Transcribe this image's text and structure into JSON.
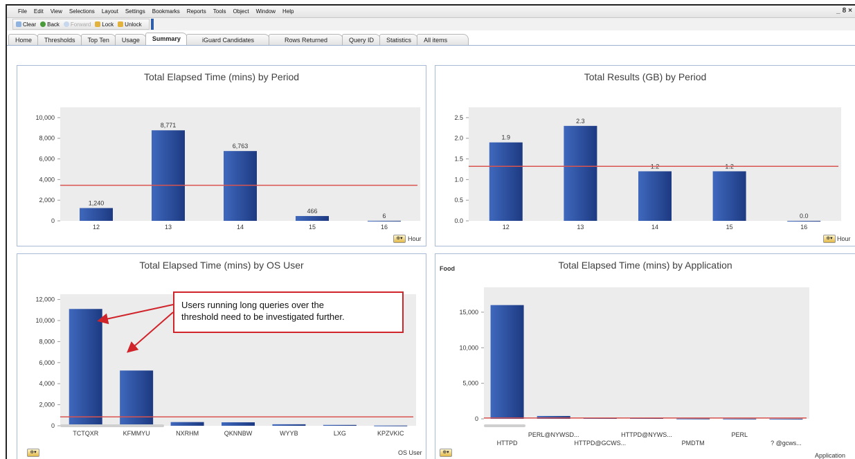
{
  "menu": [
    "File",
    "Edit",
    "View",
    "Selections",
    "Layout",
    "Settings",
    "Bookmarks",
    "Reports",
    "Tools",
    "Object",
    "Window",
    "Help"
  ],
  "window_controls": [
    "_",
    "8",
    "×"
  ],
  "toolbar": {
    "clear": "Clear",
    "back": "Back",
    "forward": "Forward",
    "lock": "Lock",
    "unlock": "Unlock"
  },
  "tabs": [
    "Home",
    "Thresholds",
    "Top Ten",
    "Usage",
    "Summary",
    "iGuard Candidates",
    "Rows Returned",
    "Query ID",
    "Statistics",
    "All items"
  ],
  "active_tab": "Summary",
  "panels": {
    "elapsed_period": {
      "unit": "Hour"
    },
    "results_period": {
      "unit": "Hour"
    },
    "elapsed_osuser": {
      "unit": "OS User"
    },
    "elapsed_app": {
      "unit": "Application",
      "corner_label": "Food"
    }
  },
  "callout": {
    "line1": "Users running long queries over the",
    "line2": "threshold need to be investigated further."
  },
  "colors": {
    "bar": "#2c4f9e",
    "threshold": "#d9534f",
    "panel_border": "#a9bad6"
  },
  "chart_data": [
    {
      "type": "bar",
      "title": "Total Elapsed Time (mins) by Period",
      "categories": [
        "12",
        "13",
        "14",
        "15",
        "16"
      ],
      "values": [
        1240,
        8771,
        6763,
        466,
        6
      ],
      "data_labels": [
        "1,240",
        "8,771",
        "6,763",
        "466",
        "6"
      ],
      "yticks": [
        "0",
        "2,000",
        "4,000",
        "6,000",
        "8,000",
        "10,000"
      ],
      "ylim": [
        0,
        11000
      ],
      "threshold": 3450
    },
    {
      "type": "bar",
      "title": "Total Results (GB) by Period",
      "categories": [
        "12",
        "13",
        "14",
        "15",
        "16"
      ],
      "values": [
        1.9,
        2.3,
        1.2,
        1.2,
        0.0
      ],
      "data_labels": [
        "1.9",
        "2.3",
        "1.2",
        "1.2",
        "0.0"
      ],
      "yticks": [
        "0.0",
        "0.5",
        "1.0",
        "1.5",
        "2.0",
        "2.5"
      ],
      "ylim": [
        0,
        2.75
      ],
      "threshold": 1.32
    },
    {
      "type": "bar",
      "title": "Total Elapsed Time (mins) by OS User",
      "categories": [
        "TCTQXR",
        "KFMMYU",
        "NXRHM",
        "QKNNBW",
        "WYYB",
        "LXG",
        "KPZVKIC"
      ],
      "values": [
        11100,
        5250,
        350,
        330,
        140,
        80,
        20
      ],
      "yticks": [
        "0",
        "2,000",
        "4,000",
        "6,000",
        "8,000",
        "10,000",
        "12,000"
      ],
      "ylim": [
        0,
        12500
      ],
      "threshold": 850
    },
    {
      "type": "bar",
      "title": "Total Elapsed Time (mins) by Application",
      "categories": [
        "HTTPD",
        "PERL@NYWSD...",
        "HTTPD@GCWS...",
        "HTTPD@NYWS...",
        "PMDTM",
        "PERL",
        "? @gcws..."
      ],
      "values": [
        16000,
        400,
        150,
        120,
        30,
        20,
        10
      ],
      "yticks": [
        "0",
        "5,000",
        "10,000",
        "15,000"
      ],
      "ylim": [
        0,
        18500
      ],
      "threshold": 120
    }
  ]
}
